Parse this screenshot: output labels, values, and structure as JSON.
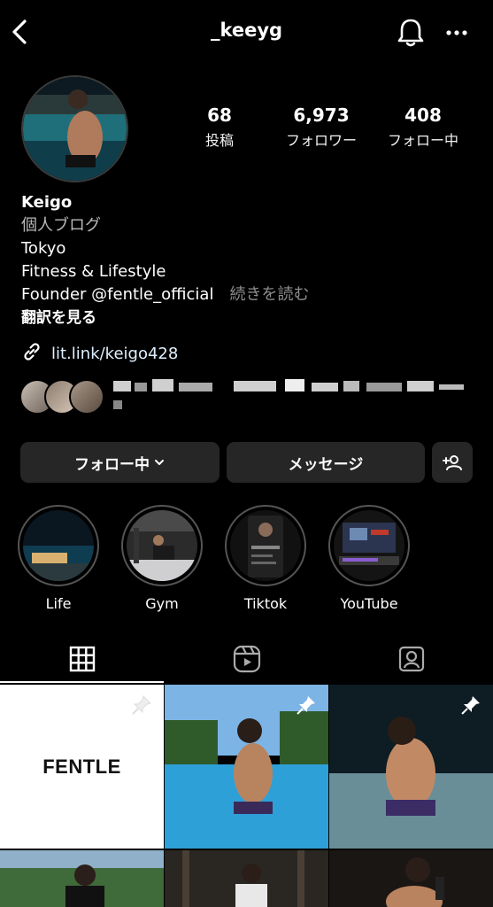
{
  "header": {
    "username": "_keeyg"
  },
  "profile": {
    "stats": [
      {
        "value": "68",
        "label": "投稿"
      },
      {
        "value": "6,973",
        "label": "フォロワー"
      },
      {
        "value": "408",
        "label": "フォロー中"
      }
    ],
    "bio": {
      "name": "Keigo",
      "category": "個人ブログ",
      "lines": [
        "Tokyo",
        "Fitness & Lifestyle"
      ],
      "founder": "Founder @fentle_official",
      "read_more": "続きを読む",
      "translate": "翻訳を見る"
    },
    "link": "lit.link/keigo428"
  },
  "actions": {
    "following_label": "フォロー中",
    "message_label": "メッセージ"
  },
  "highlights": [
    {
      "label": "Life"
    },
    {
      "label": "Gym"
    },
    {
      "label": "Tiktok"
    },
    {
      "label": "YouTube"
    }
  ],
  "grid": {
    "fentle_text": "FENTLE"
  },
  "colors": {
    "background": "#000000",
    "button": "#262626",
    "muted_text": "#8e8e8e"
  }
}
